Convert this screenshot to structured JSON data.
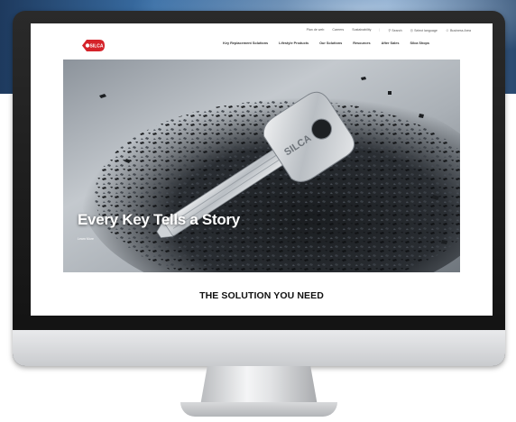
{
  "utility_nav": {
    "links": [
      "Plan de web",
      "Careers",
      "Sustainability"
    ],
    "search_label": "Search",
    "language_label": "Select language",
    "contact_label": "Business Area"
  },
  "main_nav": {
    "logo_text": "SILCA",
    "items": [
      "Key Replacement Solutions",
      "Lifestyle Products",
      "Our Solutions",
      "Resources",
      "After Sales",
      "Silca Shops"
    ]
  },
  "hero": {
    "title": "Every Key Tells a Story",
    "link_label": "Learn More",
    "key_brand_text": "SILCA"
  },
  "section": {
    "heading": "THE SOLUTION YOU NEED"
  },
  "colors": {
    "brand_red": "#d5232a",
    "backdrop_blue": "#3a6fa6"
  }
}
